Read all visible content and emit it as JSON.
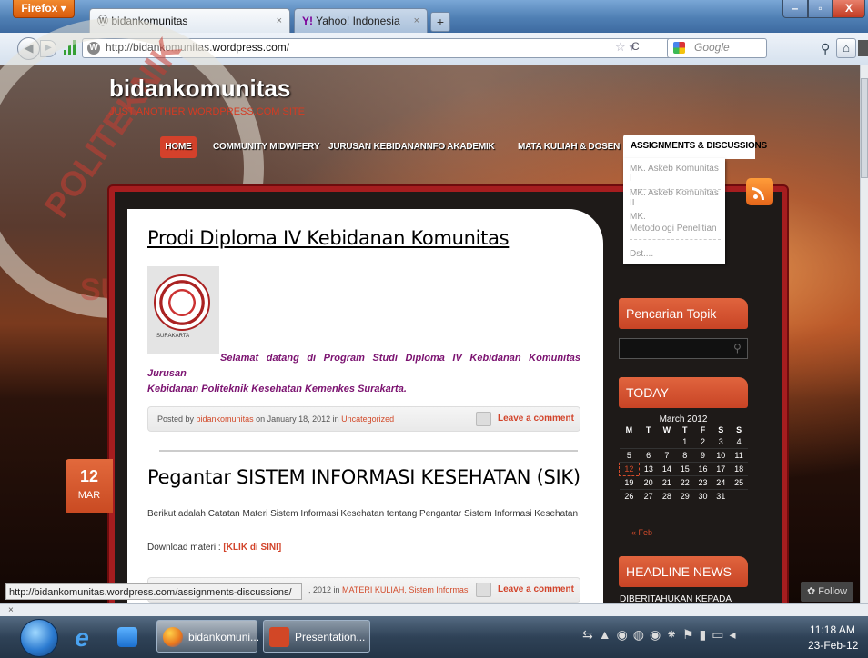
{
  "browser": {
    "menu_button": "Firefox",
    "tabs": [
      {
        "label": "bidankomunitas",
        "close": "×"
      },
      {
        "label": "Yahoo! Indonesia",
        "close": "×"
      }
    ],
    "new_tab": "+",
    "url_prefix": "http://bidankomunitas.",
    "url_domain": "wordpress.com",
    "url_suffix": "/",
    "search_placeholder": "Google",
    "status_url": "http://bidankomunitas.wordpress.com/assignments-discussions/",
    "addon_bar_close": "×"
  },
  "site": {
    "title": "bidankomunitas",
    "tagline": "JUST ANOTHER WORDPRESS.COM SITE",
    "watermark_text_1": "POLITEKNIK",
    "watermark_text_2": "SU",
    "menu": [
      "HOME",
      "COMMUNITY MIDWIFERY",
      "JURUSAN KEBIDANAN",
      "INFO AKADEMIK",
      "MATA KULIAH & DOSEN",
      "ASSIGNMENTS & DISCUSSIONS"
    ],
    "dropdown": [
      "MK. Askeb Komunitas I",
      "MK. Askeb Komunitas II",
      "MK.",
      "Metodologi Penelitian",
      "Dst...."
    ]
  },
  "posts": [
    {
      "title": "Prodi Diploma IV Kebidanan Komunitas",
      "logo_caption": "SURAKARTA",
      "excerpt_line1": "Selamat datang di Program Studi Diploma IV Kebidanan Komunitas Jurusan",
      "excerpt_line2": "Kebidanan Politeknik Kesehatan Kemenkes Surakarta.",
      "meta_pre": "Posted by ",
      "author": "bidankomunitas",
      "meta_mid": " on January 18, 2012 in ",
      "category": "Uncategorized",
      "comment": "Leave a comment"
    },
    {
      "title": "Pegantar SISTEM INFORMASI KESEHATAN (SIK)",
      "date_day": "12",
      "date_month": "MAR",
      "text": "Berikut adalah Catatan Materi Sistem Informasi Kesehatan  tentang Pengantar Sistem Informasi Kesehatan",
      "download_label": "Download materi : ",
      "download_link": "[KLIK di SINI]",
      "meta_visible": ", 2012 in ",
      "category": "MATERI KULIAH, Sistem Informasi",
      "comment": "Leave a comment"
    }
  ],
  "sidebar": {
    "search_heading": "Pencarian Topik",
    "today_heading": "TODAY",
    "calendar_caption": "March 2012",
    "calendar_days": [
      "M",
      "T",
      "W",
      "T",
      "F",
      "S",
      "S"
    ],
    "calendar_rows": [
      [
        "",
        "",
        "",
        "1",
        "2",
        "3",
        "4"
      ],
      [
        "5",
        "6",
        "7",
        "8",
        "9",
        "10",
        "11"
      ],
      [
        "12",
        "13",
        "14",
        "15",
        "16",
        "17",
        "18"
      ],
      [
        "19",
        "20",
        "21",
        "22",
        "23",
        "24",
        "25"
      ],
      [
        "26",
        "27",
        "28",
        "29",
        "30",
        "31",
        ""
      ]
    ],
    "calendar_today": "12",
    "calendar_prev": "« Feb",
    "headline_heading": "HEADLINE NEWS",
    "headline_text": "DIBERITAHUKAN KEPADA",
    "follow": "Follow"
  },
  "taskbar": {
    "items": [
      "bidankomuni...",
      "Presentation..."
    ],
    "time": "11:18 AM",
    "date": "23-Feb-12"
  },
  "colors": {
    "accent": "#d24b2b",
    "frame": "#a61d1f",
    "excerpt": "#7b1270"
  }
}
